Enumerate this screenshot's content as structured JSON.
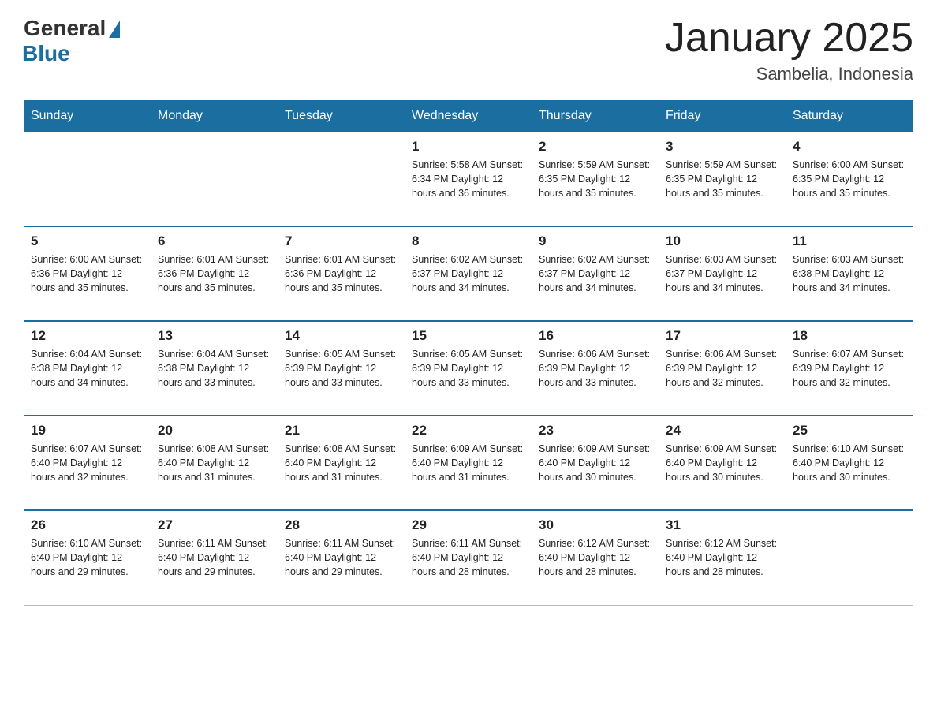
{
  "header": {
    "logo_general": "General",
    "logo_blue": "Blue",
    "month_title": "January 2025",
    "location": "Sambelia, Indonesia"
  },
  "days_of_week": [
    "Sunday",
    "Monday",
    "Tuesday",
    "Wednesday",
    "Thursday",
    "Friday",
    "Saturday"
  ],
  "weeks": [
    [
      {
        "day": "",
        "info": ""
      },
      {
        "day": "",
        "info": ""
      },
      {
        "day": "",
        "info": ""
      },
      {
        "day": "1",
        "info": "Sunrise: 5:58 AM\nSunset: 6:34 PM\nDaylight: 12 hours\nand 36 minutes."
      },
      {
        "day": "2",
        "info": "Sunrise: 5:59 AM\nSunset: 6:35 PM\nDaylight: 12 hours\nand 35 minutes."
      },
      {
        "day": "3",
        "info": "Sunrise: 5:59 AM\nSunset: 6:35 PM\nDaylight: 12 hours\nand 35 minutes."
      },
      {
        "day": "4",
        "info": "Sunrise: 6:00 AM\nSunset: 6:35 PM\nDaylight: 12 hours\nand 35 minutes."
      }
    ],
    [
      {
        "day": "5",
        "info": "Sunrise: 6:00 AM\nSunset: 6:36 PM\nDaylight: 12 hours\nand 35 minutes."
      },
      {
        "day": "6",
        "info": "Sunrise: 6:01 AM\nSunset: 6:36 PM\nDaylight: 12 hours\nand 35 minutes."
      },
      {
        "day": "7",
        "info": "Sunrise: 6:01 AM\nSunset: 6:36 PM\nDaylight: 12 hours\nand 35 minutes."
      },
      {
        "day": "8",
        "info": "Sunrise: 6:02 AM\nSunset: 6:37 PM\nDaylight: 12 hours\nand 34 minutes."
      },
      {
        "day": "9",
        "info": "Sunrise: 6:02 AM\nSunset: 6:37 PM\nDaylight: 12 hours\nand 34 minutes."
      },
      {
        "day": "10",
        "info": "Sunrise: 6:03 AM\nSunset: 6:37 PM\nDaylight: 12 hours\nand 34 minutes."
      },
      {
        "day": "11",
        "info": "Sunrise: 6:03 AM\nSunset: 6:38 PM\nDaylight: 12 hours\nand 34 minutes."
      }
    ],
    [
      {
        "day": "12",
        "info": "Sunrise: 6:04 AM\nSunset: 6:38 PM\nDaylight: 12 hours\nand 34 minutes."
      },
      {
        "day": "13",
        "info": "Sunrise: 6:04 AM\nSunset: 6:38 PM\nDaylight: 12 hours\nand 33 minutes."
      },
      {
        "day": "14",
        "info": "Sunrise: 6:05 AM\nSunset: 6:39 PM\nDaylight: 12 hours\nand 33 minutes."
      },
      {
        "day": "15",
        "info": "Sunrise: 6:05 AM\nSunset: 6:39 PM\nDaylight: 12 hours\nand 33 minutes."
      },
      {
        "day": "16",
        "info": "Sunrise: 6:06 AM\nSunset: 6:39 PM\nDaylight: 12 hours\nand 33 minutes."
      },
      {
        "day": "17",
        "info": "Sunrise: 6:06 AM\nSunset: 6:39 PM\nDaylight: 12 hours\nand 32 minutes."
      },
      {
        "day": "18",
        "info": "Sunrise: 6:07 AM\nSunset: 6:39 PM\nDaylight: 12 hours\nand 32 minutes."
      }
    ],
    [
      {
        "day": "19",
        "info": "Sunrise: 6:07 AM\nSunset: 6:40 PM\nDaylight: 12 hours\nand 32 minutes."
      },
      {
        "day": "20",
        "info": "Sunrise: 6:08 AM\nSunset: 6:40 PM\nDaylight: 12 hours\nand 31 minutes."
      },
      {
        "day": "21",
        "info": "Sunrise: 6:08 AM\nSunset: 6:40 PM\nDaylight: 12 hours\nand 31 minutes."
      },
      {
        "day": "22",
        "info": "Sunrise: 6:09 AM\nSunset: 6:40 PM\nDaylight: 12 hours\nand 31 minutes."
      },
      {
        "day": "23",
        "info": "Sunrise: 6:09 AM\nSunset: 6:40 PM\nDaylight: 12 hours\nand 30 minutes."
      },
      {
        "day": "24",
        "info": "Sunrise: 6:09 AM\nSunset: 6:40 PM\nDaylight: 12 hours\nand 30 minutes."
      },
      {
        "day": "25",
        "info": "Sunrise: 6:10 AM\nSunset: 6:40 PM\nDaylight: 12 hours\nand 30 minutes."
      }
    ],
    [
      {
        "day": "26",
        "info": "Sunrise: 6:10 AM\nSunset: 6:40 PM\nDaylight: 12 hours\nand 29 minutes."
      },
      {
        "day": "27",
        "info": "Sunrise: 6:11 AM\nSunset: 6:40 PM\nDaylight: 12 hours\nand 29 minutes."
      },
      {
        "day": "28",
        "info": "Sunrise: 6:11 AM\nSunset: 6:40 PM\nDaylight: 12 hours\nand 29 minutes."
      },
      {
        "day": "29",
        "info": "Sunrise: 6:11 AM\nSunset: 6:40 PM\nDaylight: 12 hours\nand 28 minutes."
      },
      {
        "day": "30",
        "info": "Sunrise: 6:12 AM\nSunset: 6:40 PM\nDaylight: 12 hours\nand 28 minutes."
      },
      {
        "day": "31",
        "info": "Sunrise: 6:12 AM\nSunset: 6:40 PM\nDaylight: 12 hours\nand 28 minutes."
      },
      {
        "day": "",
        "info": ""
      }
    ]
  ]
}
